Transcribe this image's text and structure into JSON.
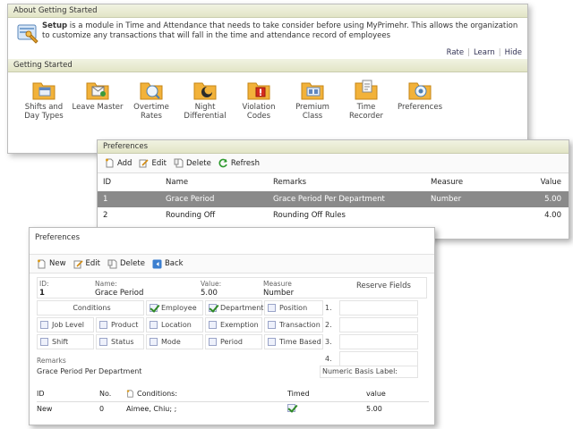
{
  "about": {
    "header": "About Getting Started",
    "setup_bold": "Setup",
    "text": " is a module in Time and Attendance that needs to take consider before using MyPrimehr. This allows the organization to customize any transactions that will fall in the time and attendance record of employees",
    "links": [
      "Rate",
      "Learn",
      "Hide"
    ]
  },
  "getting_started": {
    "header": "Getting Started",
    "items": [
      {
        "label": "Shifts and Day Types",
        "icon": "shifts-icon"
      },
      {
        "label": "Leave Master",
        "icon": "leave-icon"
      },
      {
        "label": "Overtime Rates",
        "icon": "overtime-icon"
      },
      {
        "label": "Night Differential",
        "icon": "night-icon"
      },
      {
        "label": "Violation Codes",
        "icon": "violation-icon"
      },
      {
        "label": "Premium Class",
        "icon": "premium-icon"
      },
      {
        "label": "Time Recorder",
        "icon": "time-recorder-icon"
      },
      {
        "label": "Preferences",
        "icon": "preferences-icon"
      }
    ]
  },
  "pref_list": {
    "header": "Preferences",
    "toolbar": {
      "add": "Add",
      "edit": "Edit",
      "delete": "Delete",
      "refresh": "Refresh"
    },
    "columns": [
      "ID",
      "Name",
      "Remarks",
      "Measure",
      "Value"
    ],
    "rows": [
      {
        "id": "1",
        "name": "Grace Period",
        "remarks": "Grace Period Per Department",
        "measure": "Number",
        "value": "5.00"
      },
      {
        "id": "2",
        "name": "Rounding Off",
        "remarks": "Rounding Off Rules",
        "measure": "",
        "value": "4.00"
      }
    ]
  },
  "pref_detail": {
    "header": "Preferences",
    "toolbar": {
      "new": "New",
      "edit": "Edit",
      "delete": "Delete",
      "back": "Back"
    },
    "fields": {
      "id_label": "ID:",
      "id_value": "1",
      "name_label": "Name:",
      "name_value": "Grace Period",
      "value_label": "Value:",
      "value_value": "5.00",
      "measure_label": "Measure",
      "measure_value": "Number",
      "reserve_label": "Reserve Fields"
    },
    "conditions_label": "Conditions",
    "conditions": [
      {
        "label": "Employee",
        "checked": true
      },
      {
        "label": "Department",
        "checked": true
      },
      {
        "label": "Position",
        "checked": false
      },
      {
        "label": "Job Level",
        "checked": false
      },
      {
        "label": "Product",
        "checked": false
      },
      {
        "label": "Location",
        "checked": false
      },
      {
        "label": "Exemption",
        "checked": false
      },
      {
        "label": "Transaction",
        "checked": false
      },
      {
        "label": "Shift",
        "checked": false
      },
      {
        "label": "Status",
        "checked": false
      },
      {
        "label": "Mode",
        "checked": false
      },
      {
        "label": "Period",
        "checked": false
      },
      {
        "label": "Time Based",
        "checked": false
      }
    ],
    "reserve_numbers": [
      "1.",
      "2.",
      "3.",
      "4."
    ],
    "remarks_label": "Remarks",
    "remarks_value": "Grace Period Per Department",
    "numeric_basis_label": "Numeric Basis Label:",
    "table": {
      "columns": [
        "ID",
        "No.",
        "Conditions:",
        "Timed",
        "value"
      ],
      "rows": [
        {
          "id": "New",
          "no": "0",
          "conditions": "Aimee, Chiu; ;",
          "timed": true,
          "value": "5.00"
        }
      ]
    }
  }
}
